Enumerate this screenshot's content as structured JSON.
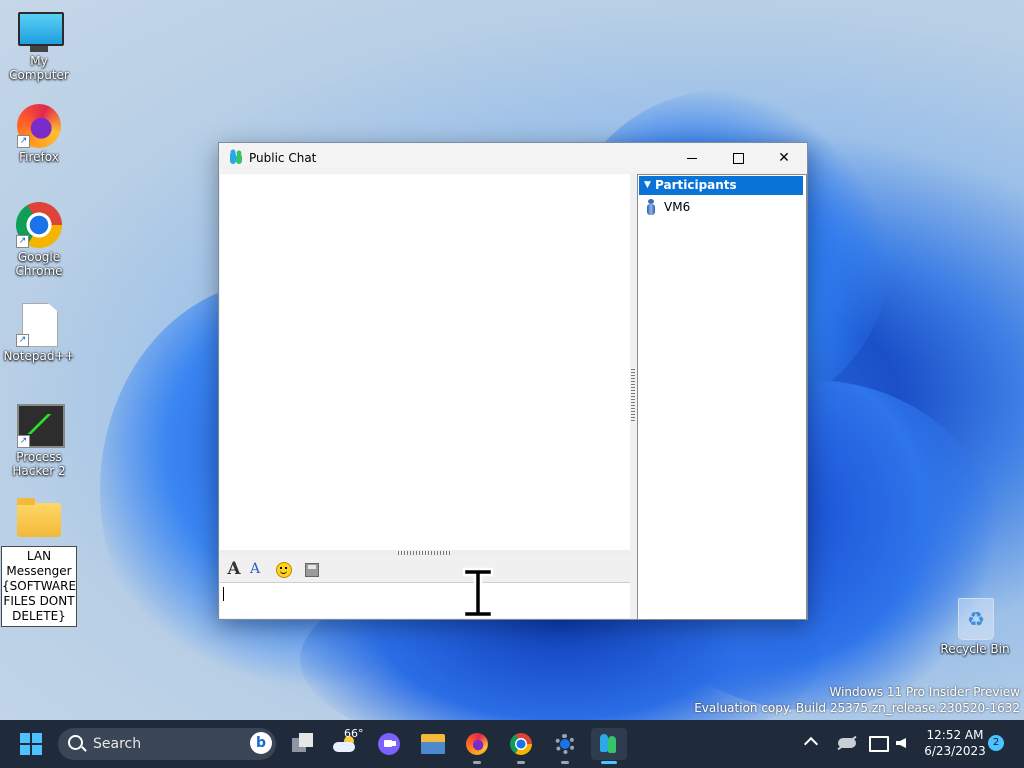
{
  "desktop": {
    "icons": [
      {
        "label": "My Computer"
      },
      {
        "label": "Firefox"
      },
      {
        "label": "Google Chrome"
      },
      {
        "label": "Notepad++"
      },
      {
        "label": "Process Hacker 2"
      },
      {
        "label": "LAN Messenger {SOFTWARE FILES DONT DELETE}"
      },
      {
        "label": "Recycle Bin"
      }
    ],
    "watermark_line1": "Windows 11 Pro Insider Preview",
    "watermark_line2": "Evaluation copy. Build 25375.zn_release.230520-1632"
  },
  "window": {
    "title": "Public Chat",
    "participants_title": "Participants",
    "participants": [
      {
        "name": "VM6"
      }
    ],
    "message_input_value": ""
  },
  "taskbar": {
    "search_placeholder": "Search",
    "weather_temp": "66°",
    "clock_time": "12:52 AM",
    "clock_date": "6/23/2023",
    "notification_count": "2"
  }
}
